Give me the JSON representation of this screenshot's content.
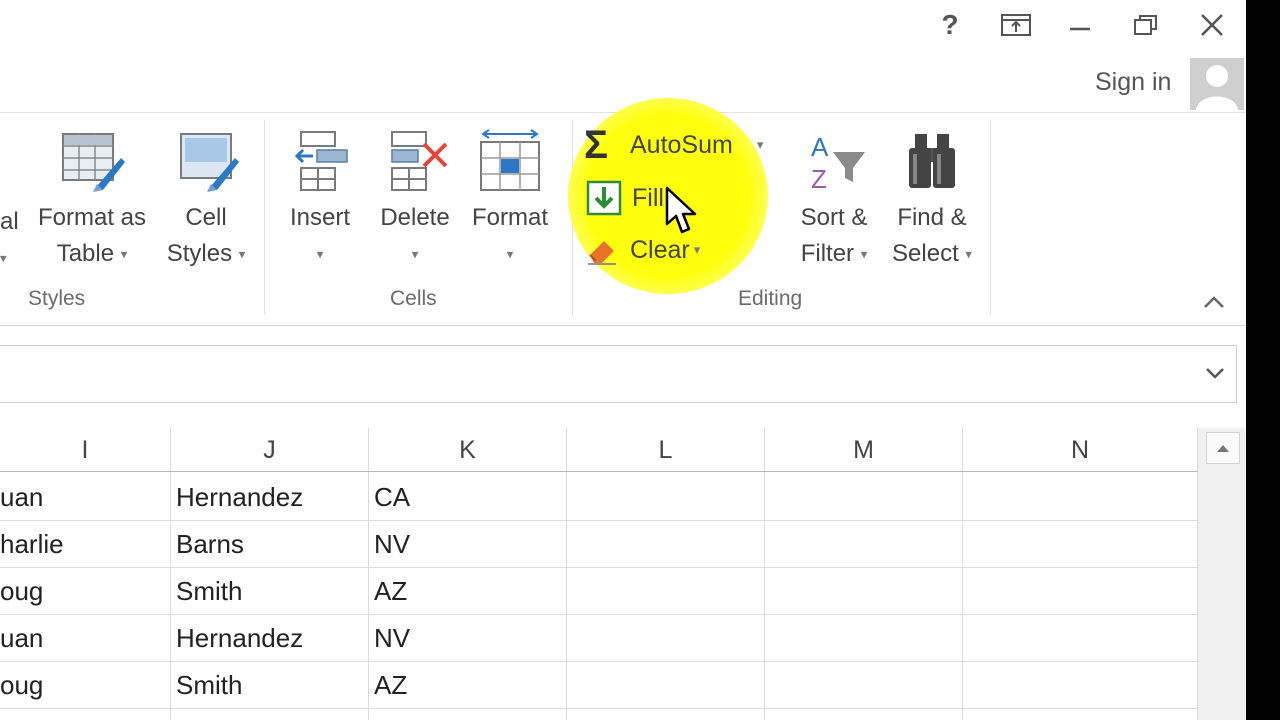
{
  "window": {
    "help": "?",
    "sign_in": "Sign in"
  },
  "ribbon": {
    "styles_group": {
      "partial_label_1": "al",
      "format_as_table": [
        "Format as",
        "Table"
      ],
      "cell_styles": [
        "Cell",
        "Styles"
      ],
      "label": "Styles"
    },
    "cells_group": {
      "insert": "Insert",
      "delete": "Delete",
      "format": "Format",
      "label": "Cells"
    },
    "editing_group": {
      "autosum": "AutoSum",
      "fill": "Fill",
      "clear": "Clear",
      "sort_filter": [
        "Sort &",
        "Filter"
      ],
      "find_select": [
        "Find &",
        "Select"
      ],
      "label": "Editing"
    }
  },
  "grid": {
    "columns": [
      "I",
      "J",
      "K",
      "L",
      "M",
      "N"
    ],
    "rows": [
      [
        "uan",
        "Hernandez",
        "CA",
        "",
        "",
        ""
      ],
      [
        "harlie",
        "Barns",
        "NV",
        "",
        "",
        ""
      ],
      [
        "oug",
        "Smith",
        "AZ",
        "",
        "",
        ""
      ],
      [
        "uan",
        "Hernandez",
        "NV",
        "",
        "",
        ""
      ],
      [
        "oug",
        "Smith",
        "AZ",
        "",
        "",
        ""
      ]
    ]
  },
  "colors": {
    "highlight": "#ffff00",
    "fill_icon_green": "#2e8b3a",
    "delete_x_red": "#e8433a",
    "accent_blue": "#2b78c6"
  }
}
